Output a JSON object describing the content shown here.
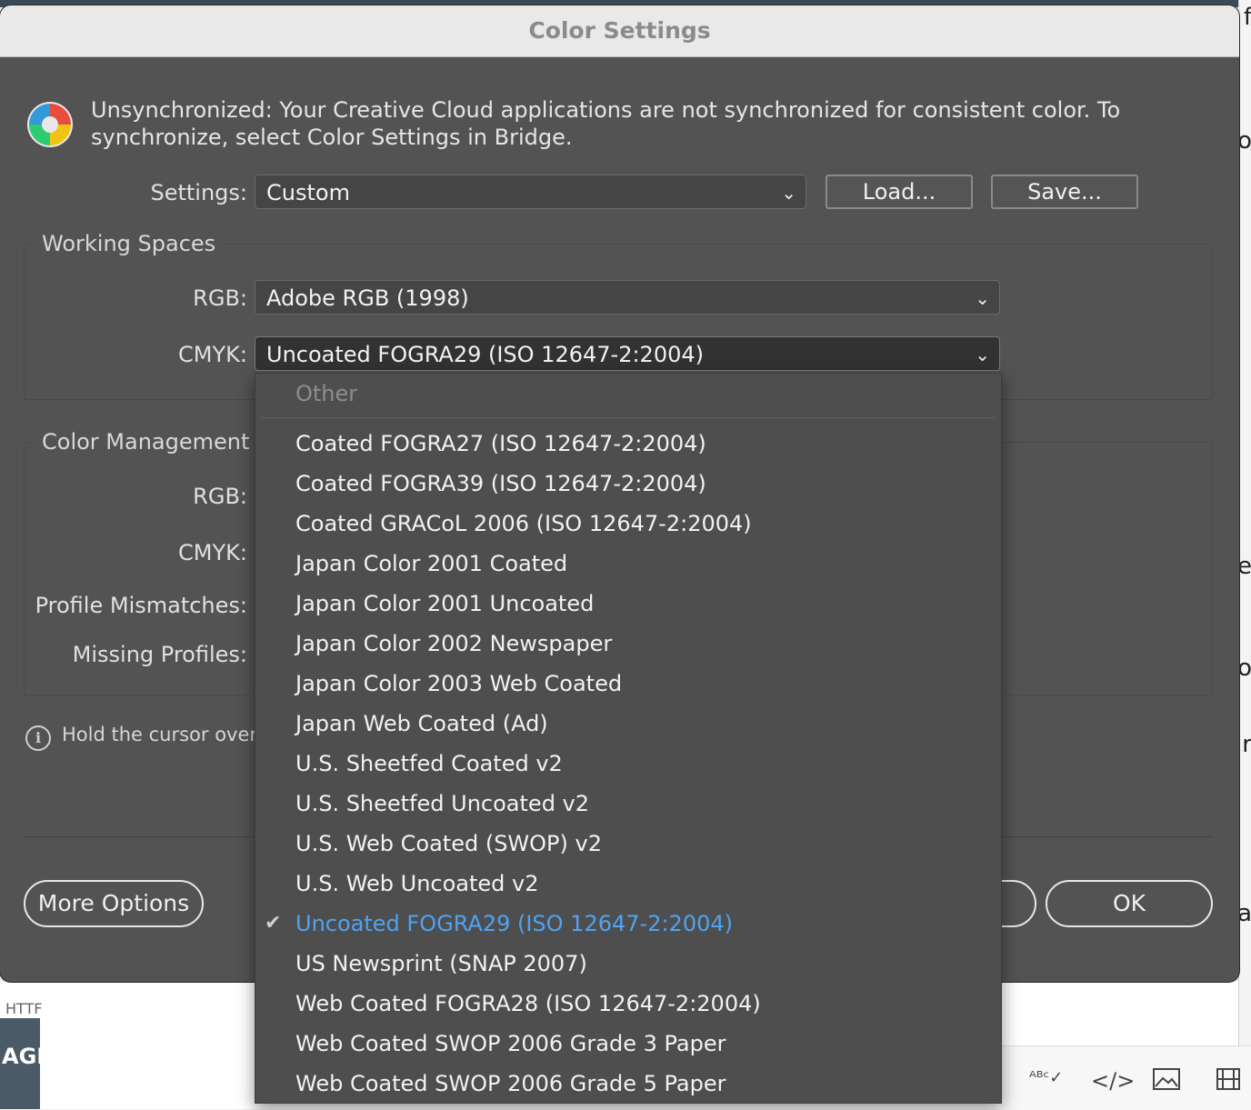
{
  "dialog": {
    "title": "Color Settings",
    "sync_message": "Unsynchronized: Your Creative Cloud applications are not synchronized for consistent color. To synchronize, select Color Settings in Bridge."
  },
  "settings": {
    "label": "Settings:",
    "value": "Custom",
    "load_label": "Load...",
    "save_label": "Save..."
  },
  "working_spaces": {
    "title": "Working Spaces",
    "rgb_label": "RGB:",
    "rgb_value": "Adobe RGB (1998)",
    "cmyk_label": "CMYK:",
    "cmyk_value": "Uncoated FOGRA29 (ISO 12647-2:2004)"
  },
  "color_management": {
    "title": "Color Management P",
    "rgb_label": "RGB:",
    "cmyk_label": "CMYK:",
    "mismatch_label": "Profile Mismatches:",
    "missing_label": "Missing Profiles:"
  },
  "info": {
    "text": "Hold the cursor over a"
  },
  "footer": {
    "more_options": "More Options",
    "ok": "OK"
  },
  "cmyk_menu": {
    "header": "Other",
    "items": [
      "Coated FOGRA27 (ISO 12647-2:2004)",
      "Coated FOGRA39 (ISO 12647-2:2004)",
      "Coated GRACoL 2006 (ISO 12647-2:2004)",
      "Japan Color 2001 Coated",
      "Japan Color 2001 Uncoated",
      "Japan Color 2002 Newspaper",
      "Japan Color 2003 Web Coated",
      "Japan Web Coated (Ad)",
      "U.S. Sheetfed Coated v2",
      "U.S. Sheetfed Uncoated v2",
      "U.S. Web Coated (SWOP) v2",
      "U.S. Web Uncoated v2",
      "Uncoated FOGRA29 (ISO 12647-2:2004)",
      "US Newsprint (SNAP 2007)",
      "Web Coated FOGRA28 (ISO 12647-2:2004)",
      "Web Coated SWOP 2006 Grade 3 Paper",
      "Web Coated SWOP 2006 Grade 5 Paper"
    ],
    "selected_index": 12,
    "selected_color": "#4ea3f2"
  },
  "background": {
    "http_text": "HTTF",
    "agi_text": "AGI"
  },
  "icons": {
    "color_wheel": "color-wheel-icon",
    "info": "info-icon",
    "checkmark": "checkmark-icon",
    "chevron": "chevron-down-icon"
  }
}
